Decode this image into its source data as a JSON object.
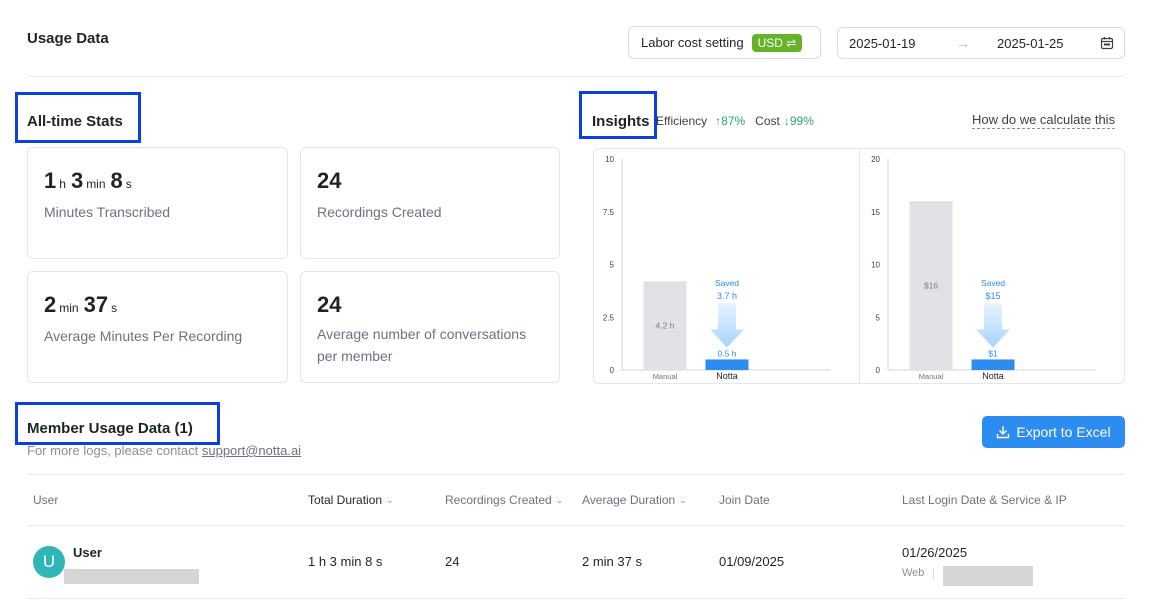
{
  "header": {
    "title": "Usage Data",
    "labor_cost_label": "Labor cost setting",
    "currency_badge": "USD ⇌",
    "date_start": "2025-01-19",
    "date_arrow": "→",
    "date_end": "2025-01-25"
  },
  "all_time_stats": {
    "title": "All-time Stats",
    "cards": [
      {
        "values": [
          {
            "num": "1",
            "unit": "h"
          },
          {
            "num": "3",
            "unit": "min"
          },
          {
            "num": "8",
            "unit": "s"
          }
        ],
        "label": "Minutes Transcribed"
      },
      {
        "values": [
          {
            "num": "24",
            "unit": ""
          }
        ],
        "label": "Recordings Created"
      },
      {
        "values": [
          {
            "num": "2",
            "unit": "min"
          },
          {
            "num": "37",
            "unit": "s"
          }
        ],
        "label": "Average Minutes Per Recording"
      },
      {
        "values": [
          {
            "num": "24",
            "unit": ""
          }
        ],
        "label": "Average number of conversations per member"
      }
    ]
  },
  "insights": {
    "title": "Insights",
    "efficiency_label": "Efficiency",
    "efficiency_value": "↑87%",
    "cost_label": "Cost",
    "cost_value": "↓99%",
    "how_link": "How do we calculate this"
  },
  "chart_data": [
    {
      "type": "bar",
      "categories": [
        "Manual",
        "Notta"
      ],
      "values": [
        4.2,
        0.5
      ],
      "data_labels": [
        "4.2 h",
        "0.5 h"
      ],
      "yticks": [
        "0",
        "2.5",
        "5",
        "7.5",
        "10"
      ],
      "ylim": [
        0,
        10
      ],
      "saved_label": "Saved",
      "saved_value": "3.7 h",
      "colors": {
        "manual": "#e1e2e6",
        "notta": "#2d8cf0"
      }
    },
    {
      "type": "bar",
      "categories": [
        "Manual",
        "Notta"
      ],
      "values": [
        16,
        1
      ],
      "data_labels": [
        "$16",
        "$1"
      ],
      "yticks": [
        "0",
        "5",
        "10",
        "15",
        "20"
      ],
      "ylim": [
        0,
        20
      ],
      "saved_label": "Saved",
      "saved_value": "$15",
      "colors": {
        "manual": "#e1e2e6",
        "notta": "#2d8cf0"
      }
    }
  ],
  "member_usage": {
    "title": "Member Usage Data (1)",
    "contact_prefix": "For more logs, please contact ",
    "contact_email": "support@notta.ai",
    "export_label": "Export to Excel",
    "columns": [
      "User",
      "Total Duration",
      "Recordings Created",
      "Average Duration",
      "Join Date",
      "Last Login Date & Service & IP"
    ],
    "rows": [
      {
        "avatar": "U",
        "name": "User",
        "total_duration": "1 h 3 min 8 s",
        "recordings": "24",
        "avg_duration": "2 min 37 s",
        "join_date": "01/09/2025",
        "last_login": "01/26/2025",
        "service": "Web"
      }
    ]
  }
}
